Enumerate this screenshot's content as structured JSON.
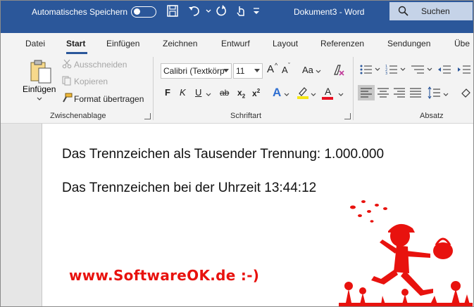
{
  "titlebar": {
    "autosave_label": "Automatisches Speichern",
    "document_title": "Dokument3 - Word",
    "search_label": "Suchen"
  },
  "tabs": [
    {
      "label": "Datei"
    },
    {
      "label": "Start",
      "active": true
    },
    {
      "label": "Einfügen"
    },
    {
      "label": "Zeichnen"
    },
    {
      "label": "Entwurf"
    },
    {
      "label": "Layout"
    },
    {
      "label": "Referenzen"
    },
    {
      "label": "Sendungen"
    },
    {
      "label": "Übe"
    }
  ],
  "clipboard": {
    "paste_label": "Einfügen",
    "cut_label": "Ausschneiden",
    "copy_label": "Kopieren",
    "format_painter_label": "Format übertragen",
    "group_label": "Zwischenablage"
  },
  "font": {
    "font_name": "Calibri (Textkörp",
    "font_size": "11",
    "bold": "F",
    "italic": "K",
    "underline": "U",
    "strikethrough": "ab",
    "subscript": "x",
    "subscript_mark": "2",
    "superscript": "x",
    "superscript_mark": "2",
    "change_case": "Aa",
    "grow": "A",
    "shrink": "A",
    "text_effects": "A",
    "font_color": "A",
    "group_label": "Schriftart",
    "highlight_color": "#f5e614",
    "font_color_value": "#e81123"
  },
  "paragraph": {
    "group_label": "Absatz"
  },
  "document": {
    "line1": "Das Trennzeichen als Tausender Trennung: 1.000.000",
    "line2": "Das Trennzeichen bei der Uhrzeit 13:44:12"
  },
  "watermark": "www.SoftwareOK.de :-)",
  "colors": {
    "title_bar": "#2b579a",
    "watermark": "#e8120e"
  }
}
